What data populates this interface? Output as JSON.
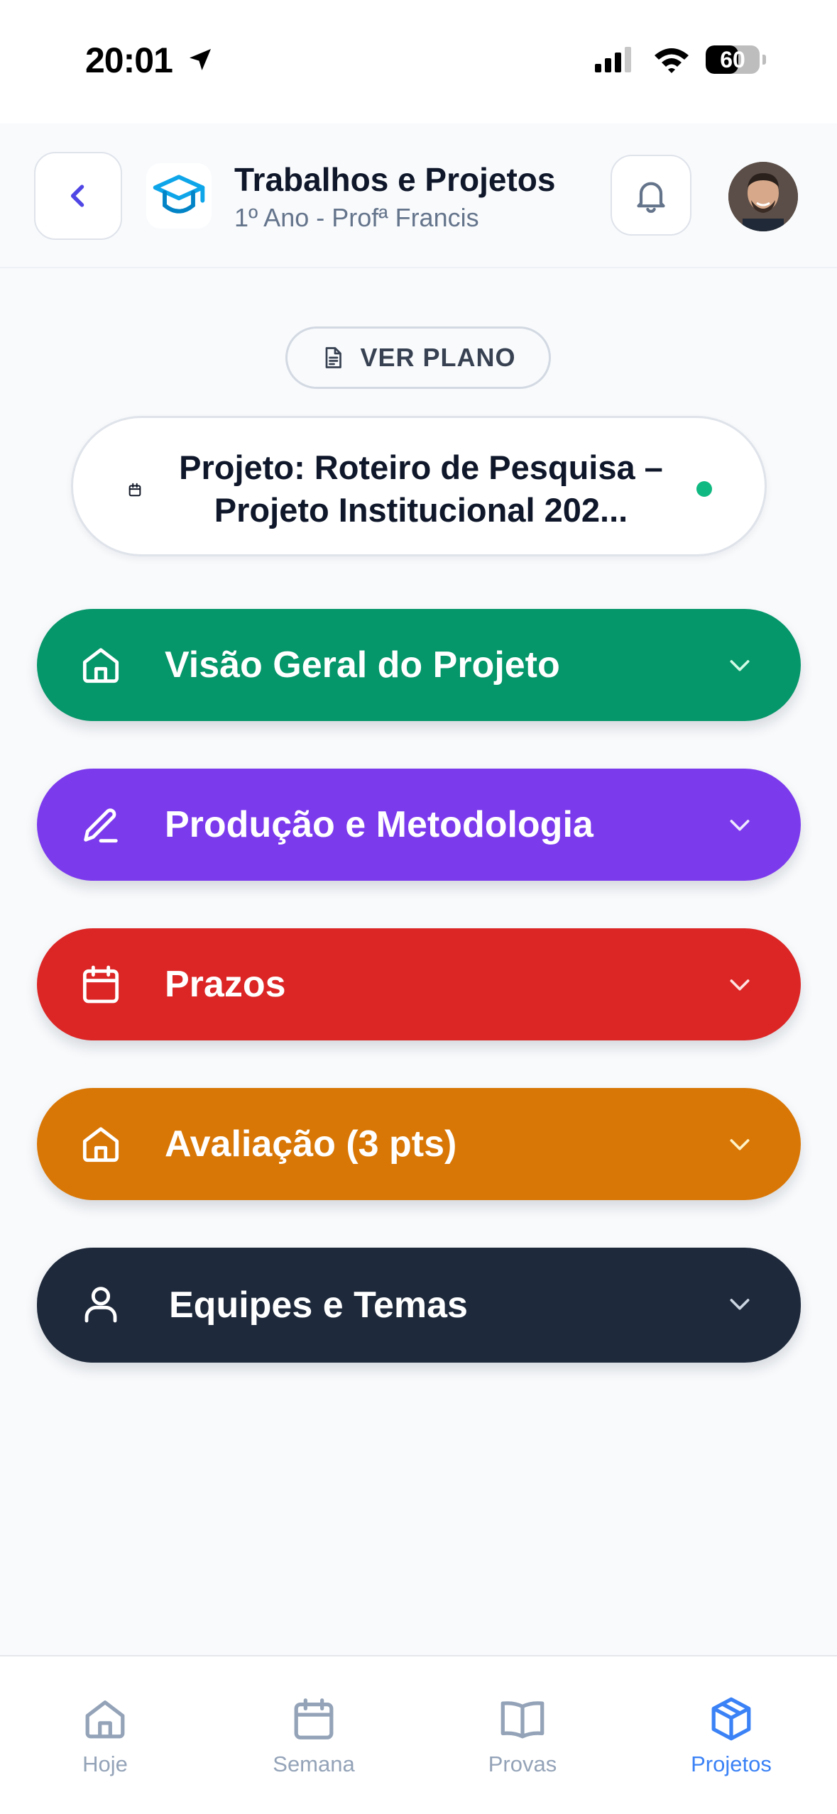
{
  "status": {
    "time": "20:01",
    "battery": "60",
    "battery_level": 0.6
  },
  "header": {
    "title": "Trabalhos e Projetos",
    "subtitle": "1º Ano - Profª Francis"
  },
  "plan_button": {
    "label": "VER PLANO"
  },
  "project": {
    "title": "Projeto: Roteiro de Pesquisa – Projeto Institucional 202...",
    "status_color": "#10b981"
  },
  "sections": [
    {
      "label": "Visão Geral do Projeto",
      "icon": "home-icon",
      "color": "#059669"
    },
    {
      "label": "Produção e Metodologia",
      "icon": "pencil-icon",
      "color": "#7c3aed"
    },
    {
      "label": "Prazos",
      "icon": "calendar-icon",
      "color": "#dc2626"
    },
    {
      "label": "Avaliação (3 pts)",
      "icon": "home-icon",
      "color": "#d97706"
    },
    {
      "label": "Equipes e Temas",
      "icon": "user-icon",
      "color": "#1e293b"
    }
  ],
  "tabs": [
    {
      "label": "Hoje",
      "icon": "home-icon"
    },
    {
      "label": "Semana",
      "icon": "calendar-icon"
    },
    {
      "label": "Provas",
      "icon": "book-icon"
    },
    {
      "label": "Projetos",
      "icon": "box-icon",
      "active": true
    }
  ]
}
